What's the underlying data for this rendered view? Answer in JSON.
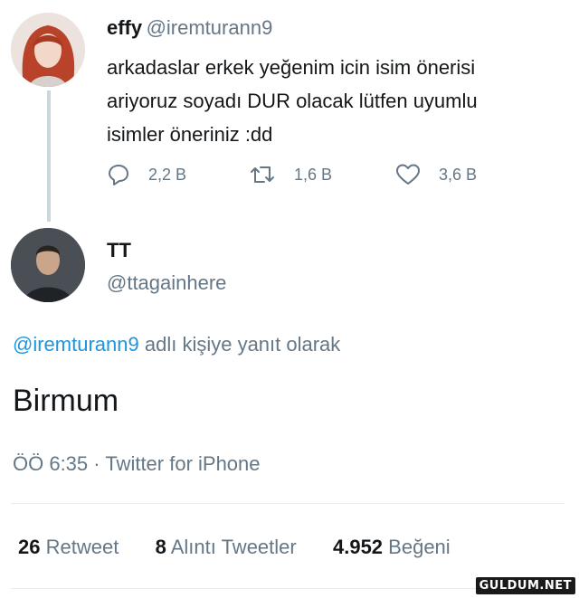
{
  "original_tweet": {
    "display_name": "effy",
    "handle": "@iremturann9",
    "text_line1": "arkadaslar erkek yeğenim icin isim önerisi",
    "text_line2": "ariyoruz soyadı DUR olacak lütfen uyumlu",
    "text_line3": "isimler öneriniz :dd",
    "replies_count": "2,2 B",
    "retweets_count": "1,6 B",
    "likes_count": "3,6 B",
    "icons": [
      "reply-icon",
      "retweet-icon",
      "like-icon"
    ]
  },
  "reply_tweet": {
    "display_name": "TT",
    "handle": "@ttagainhere",
    "reply_to_mention": "@iremturann9",
    "reply_to_suffix": "adlı kişiye yanıt olarak",
    "text": "Birmum",
    "time": "ÖÖ 6:35",
    "separator": "·",
    "source": "Twitter for iPhone"
  },
  "stats": {
    "retweets_value": "26",
    "retweets_label": "Retweet",
    "quotes_value": "8",
    "quotes_label": "Alıntı Tweetler",
    "likes_value": "4.952",
    "likes_label": "Beğeni"
  },
  "watermark": "GULDUM.NET",
  "colors": {
    "text": "#14171a",
    "secondary": "#657786",
    "link": "#1b95e0",
    "divider": "#e6ecf0"
  }
}
